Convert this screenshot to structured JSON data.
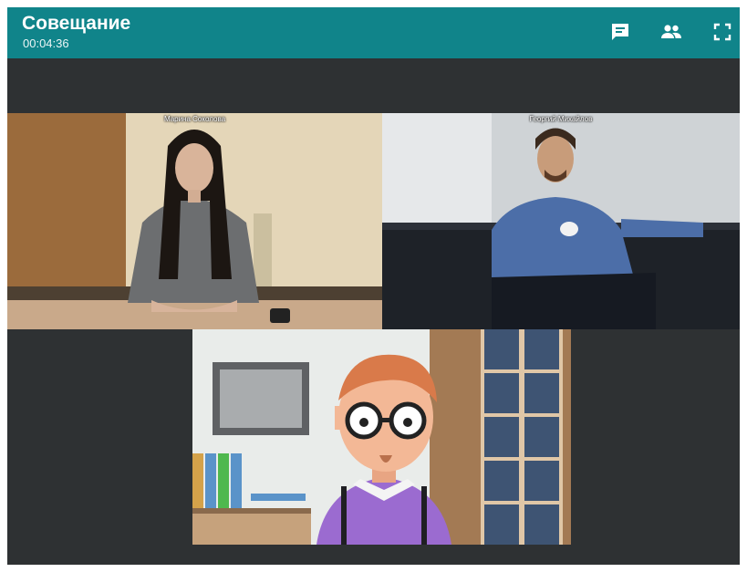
{
  "header": {
    "title": "Совещание",
    "timer": "00:04:36",
    "icons": [
      "chat-icon",
      "participants-icon",
      "fullscreen-icon"
    ]
  },
  "participants": [
    {
      "name": "Марина Соколова"
    },
    {
      "name": "Георгий Михайлов"
    },
    {
      "name": ""
    }
  ],
  "colors": {
    "header_bg": "#10848a",
    "stage_bg": "#2e3133"
  }
}
